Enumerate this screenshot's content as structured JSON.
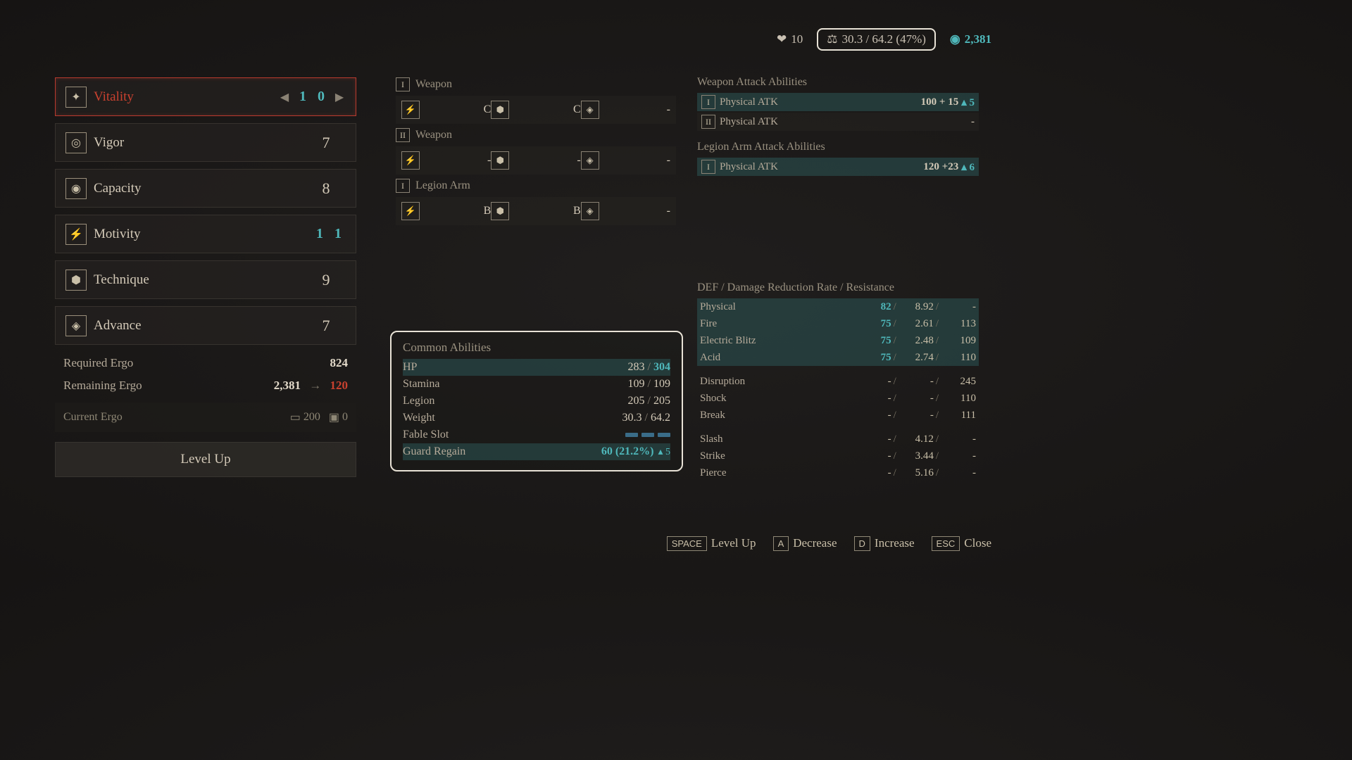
{
  "topbar": {
    "hearts": 10,
    "weight_text": "30.3 / 64.2 (47%)",
    "ergo": "2,381"
  },
  "stats": [
    {
      "name": "Vitality",
      "digits": [
        "1",
        "0"
      ],
      "selected": true,
      "icon": "vitality"
    },
    {
      "name": "Vigor",
      "value": "7",
      "icon": "vigor"
    },
    {
      "name": "Capacity",
      "value": "8",
      "icon": "capacity"
    },
    {
      "name": "Motivity",
      "digits": [
        "1",
        "1"
      ],
      "teal": true,
      "icon": "motivity"
    },
    {
      "name": "Technique",
      "value": "9",
      "icon": "technique"
    },
    {
      "name": "Advance",
      "value": "7",
      "icon": "advance"
    }
  ],
  "ergo": {
    "required_label": "Required Ergo",
    "required_value": "824",
    "remaining_label": "Remaining Ergo",
    "remaining_from": "2,381",
    "remaining_to": "120",
    "current_label": "Current Ergo",
    "current_coin": "200",
    "current_box": "0"
  },
  "level_up_btn": "Level Up",
  "equip": [
    {
      "slot": "I",
      "label": "Weapon",
      "scaling": [
        {
          "grade": "C"
        },
        {
          "grade": "C"
        },
        {
          "grade": "-"
        }
      ]
    },
    {
      "slot": "II",
      "label": "Weapon",
      "scaling": [
        {
          "grade": "-"
        },
        {
          "grade": "-"
        },
        {
          "grade": "-"
        }
      ]
    },
    {
      "slot": "I",
      "label": "Legion Arm",
      "scaling": [
        {
          "grade": "B"
        },
        {
          "grade": "B"
        },
        {
          "grade": "-"
        }
      ]
    }
  ],
  "common": {
    "title": "Common Abilities",
    "rows": [
      {
        "name": "HP",
        "cur": "283",
        "max": "304",
        "hl": true,
        "max_teal": true
      },
      {
        "name": "Stamina",
        "cur": "109",
        "max": "109"
      },
      {
        "name": "Legion",
        "cur": "205",
        "max": "205"
      },
      {
        "name": "Weight",
        "cur": "30.3",
        "max": "64.2"
      },
      {
        "name": "Fable Slot",
        "fable": 3
      },
      {
        "name": "Guard Regain",
        "text": "60 (21.2%)",
        "delta": "▴ 5",
        "hl": true,
        "teal": true
      }
    ]
  },
  "weapon_atk": {
    "title": "Weapon Attack Abilities",
    "rows": [
      {
        "slot": "I",
        "name": "Physical ATK",
        "base": "100",
        "plus": "+ 15",
        "delta": "▴ 5",
        "hl": true
      },
      {
        "slot": "II",
        "name": "Physical ATK",
        "val": "-"
      }
    ]
  },
  "legion_atk": {
    "title": "Legion Arm Attack Abilities",
    "rows": [
      {
        "slot": "I",
        "name": "Physical ATK",
        "base": "120",
        "plus": "+23",
        "delta": "▴ 6",
        "hl": true
      }
    ]
  },
  "def": {
    "title": "DEF / Damage Reduction Rate / Resistance",
    "rows": [
      {
        "name": "Physical",
        "c1": "82",
        "c1teal": true,
        "c2": "8.92",
        "c3": "-",
        "hl": true
      },
      {
        "name": "Fire",
        "c1": "75",
        "c1teal": true,
        "c2": "2.61",
        "c3": "113",
        "hl": true
      },
      {
        "name": "Electric Blitz",
        "c1": "75",
        "c1teal": true,
        "c2": "2.48",
        "c3": "109",
        "hl": true
      },
      {
        "name": "Acid",
        "c1": "75",
        "c1teal": true,
        "c2": "2.74",
        "c3": "110",
        "hl": true
      },
      {
        "gap": true
      },
      {
        "name": "Disruption",
        "c1": "-",
        "c2": "-",
        "c3": "245"
      },
      {
        "name": "Shock",
        "c1": "-",
        "c2": "-",
        "c3": "110"
      },
      {
        "name": "Break",
        "c1": "-",
        "c2": "-",
        "c3": "111"
      },
      {
        "gap": true
      },
      {
        "name": "Slash",
        "c1": "-",
        "c2": "4.12",
        "c3": "-"
      },
      {
        "name": "Strike",
        "c1": "-",
        "c2": "3.44",
        "c3": "-"
      },
      {
        "name": "Pierce",
        "c1": "-",
        "c2": "5.16",
        "c3": "-"
      }
    ]
  },
  "hints": [
    {
      "key": "SPACE",
      "label": "Level Up"
    },
    {
      "key": "A",
      "label": "Decrease"
    },
    {
      "key": "D",
      "label": "Increase"
    },
    {
      "key": "ESC",
      "label": "Close"
    }
  ]
}
